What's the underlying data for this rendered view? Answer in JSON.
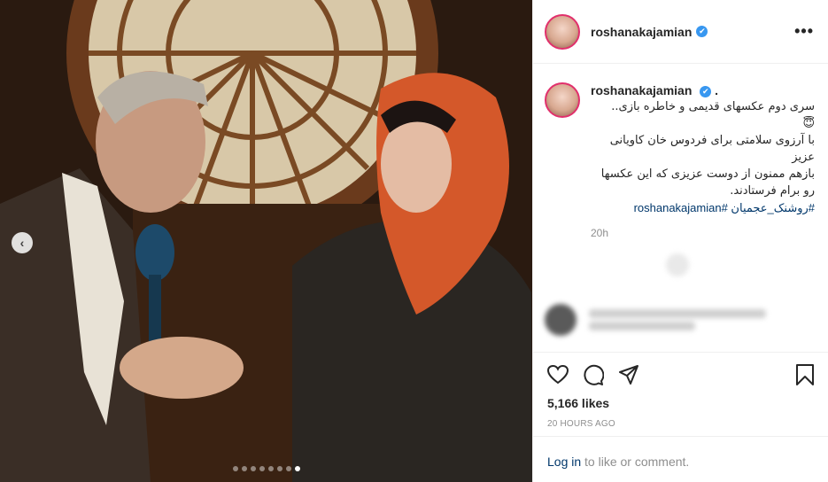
{
  "post": {
    "username": "roshanakajamian",
    "more_icon": "•••",
    "verified_icon": "✔",
    "caption_username": "roshanakajamian",
    "caption_lines": [
      "سری دوم عکسهای قدیمی و خاطره بازی..",
      "😇",
      "با آرزوی سلامتی برای فردوس خان کاویانی عزیز",
      "بازهم ممنون از دوست عزیزی که این عکسها رو برام فرستادند."
    ],
    "hashtags": "#روشنک_عجمیان #roshanakajamian",
    "caption_time": "20h",
    "likes": "5,166 likes",
    "time_ago": "20 HOURS AGO",
    "login_link": "Log in",
    "login_rest": " to like or comment."
  },
  "carousel": {
    "prev_icon": "‹",
    "dot_count": 8,
    "active_index": 7
  },
  "icons": {
    "like": "heart-icon",
    "comment": "comment-icon",
    "share": "share-icon",
    "save": "bookmark-icon"
  },
  "colors": {
    "link": "#00376b",
    "verified": "#3897f0",
    "muted": "#8e8e8e",
    "ring": "#e1306c"
  }
}
